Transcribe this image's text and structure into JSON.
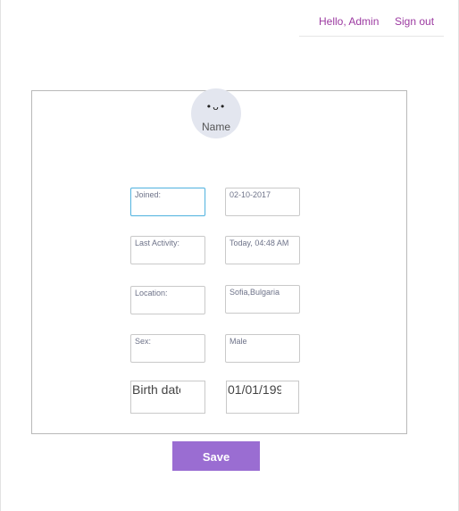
{
  "header": {
    "greeting": "Hello, Admin",
    "sign_out": "Sign out",
    "link_color": "#9c3aa1"
  },
  "profile": {
    "avatar_face": "•ᴗ•",
    "name": "Name"
  },
  "fields": {
    "joined_label": "Joined:",
    "joined_value": "02-10-2017",
    "last_activity_label": "Last Activity:",
    "last_activity_value": "Today, 04:48 AM",
    "location_label": "Location:",
    "location_value": "Sofia,Bulgaria",
    "sex_label": "Sex:",
    "sex_value": "Male",
    "birth_date_label": "Birth date",
    "birth_date_value": "01/01/199"
  },
  "actions": {
    "save": "Save",
    "save_color": "#9a6dd2"
  }
}
